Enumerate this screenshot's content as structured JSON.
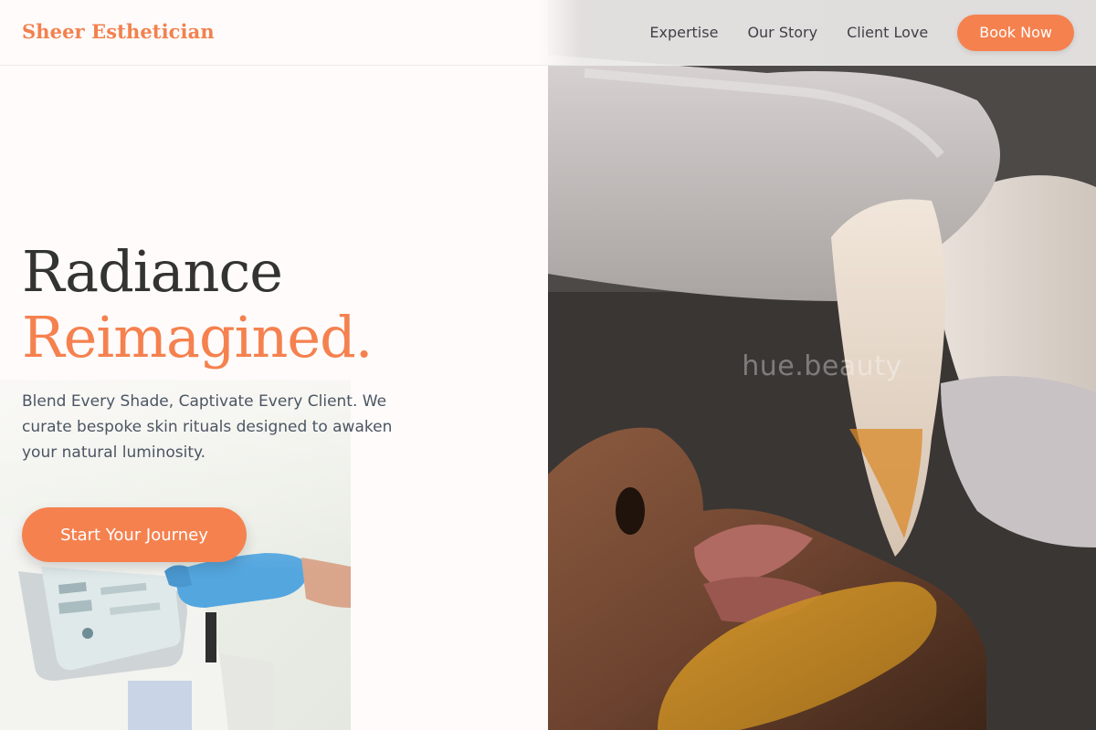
{
  "header": {
    "logo": "Sheer Esthetician",
    "nav": [
      {
        "label": "Expertise"
      },
      {
        "label": "Our Story"
      },
      {
        "label": "Client Love"
      }
    ],
    "book_button": "Book Now"
  },
  "hero": {
    "headline_line1": "Radiance",
    "headline_line2": "Reimagined.",
    "subtitle": "Blend Every Shade, Captivate Every Client. We curate bespoke skin rituals designed to awaken your natural luminosity.",
    "cta": "Start Your Journey",
    "photo_watermark": "hue.beauty"
  },
  "colors": {
    "accent": "#f5814f",
    "heading": "#333333",
    "body_text": "#4b5563",
    "background": "#fefbfa"
  },
  "icons": {
    "hero_photo": "facial-treatment-photo",
    "inset_photo": "skin-device-photo"
  }
}
